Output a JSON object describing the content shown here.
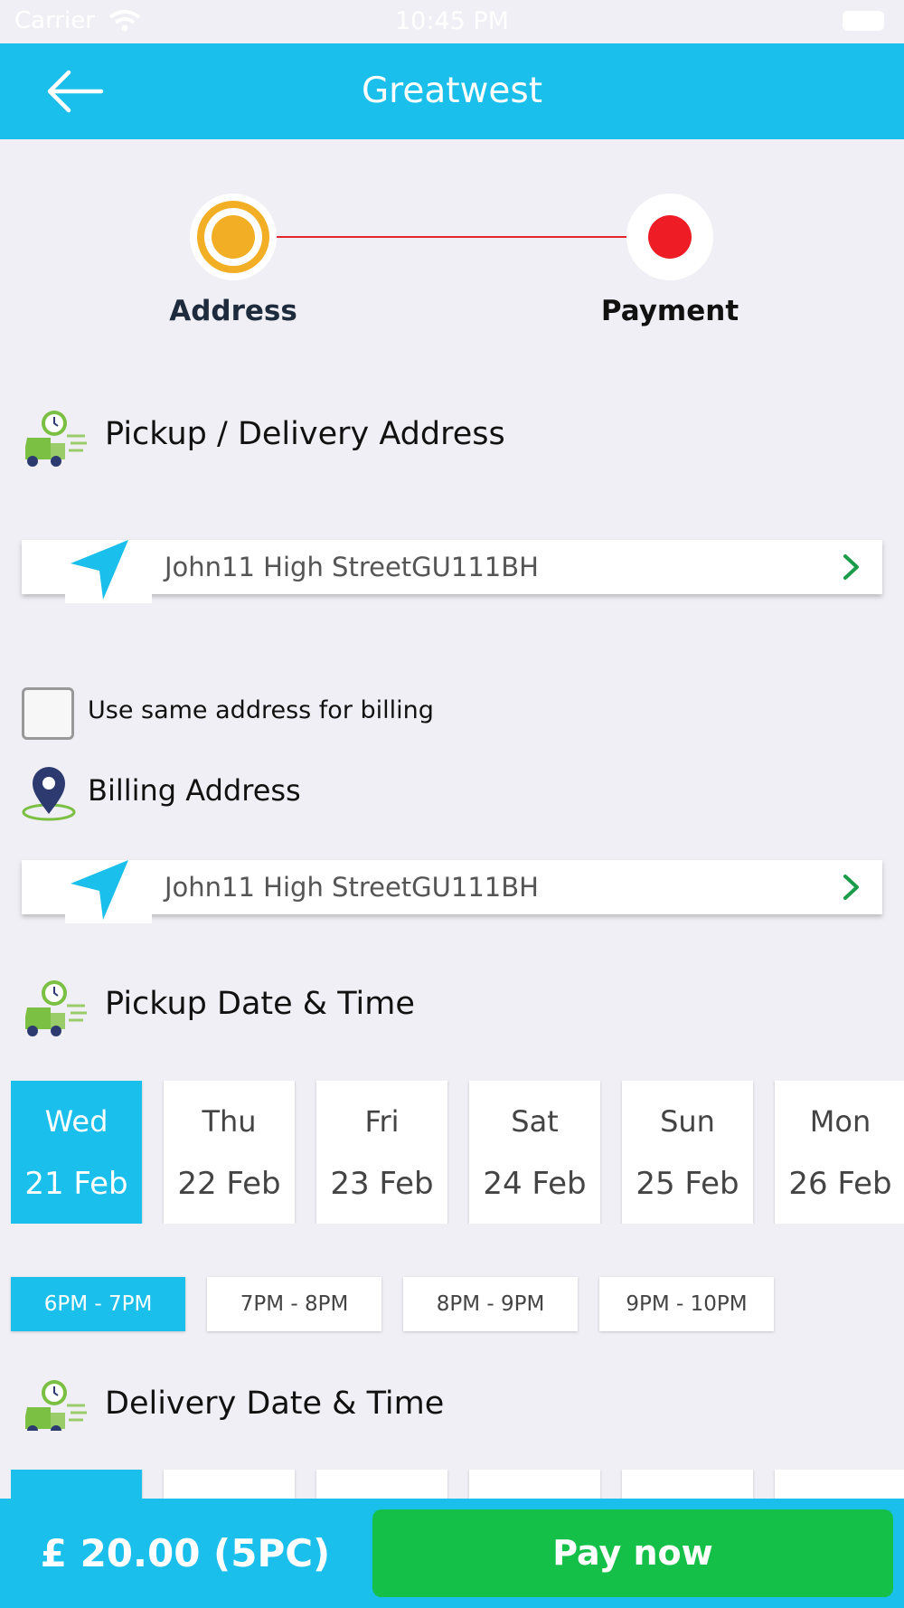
{
  "status_bar": {
    "carrier": "Carrier",
    "time": "10:45 PM"
  },
  "nav": {
    "title": "Greatwest"
  },
  "stepper": {
    "steps": [
      {
        "label": "Address"
      },
      {
        "label": "Payment"
      }
    ]
  },
  "pickup_section": {
    "title": "Pickup / Delivery Address",
    "address": "John11 High StreetGU111BH"
  },
  "billing": {
    "checkbox_label": "Use same address for billing",
    "checked": false,
    "title": "Billing Address",
    "address": "John11 High StreetGU111BH"
  },
  "pickup_datetime": {
    "title": "Pickup Date & Time",
    "dates": [
      {
        "day": "Wed",
        "date": "21 Feb"
      },
      {
        "day": "Thu",
        "date": "22 Feb"
      },
      {
        "day": "Fri",
        "date": "23 Feb"
      },
      {
        "day": "Sat",
        "date": "24 Feb"
      },
      {
        "day": "Sun",
        "date": "25 Feb"
      },
      {
        "day": "Mon",
        "date": "26 Feb"
      }
    ],
    "times": [
      "6PM - 7PM",
      "7PM - 8PM",
      "8PM - 9PM",
      "9PM - 10PM"
    ]
  },
  "delivery_datetime": {
    "title": "Delivery Date & Time"
  },
  "bottom_bar": {
    "price": "£ 20.00 (5PC)",
    "pay_label": "Pay now"
  },
  "colors": {
    "primary": "#1bbfeb",
    "pay_green": "#15c048",
    "step_active": "#f2ae24",
    "step_pending": "#ee1c25",
    "chevron": "#1a9c4a"
  }
}
